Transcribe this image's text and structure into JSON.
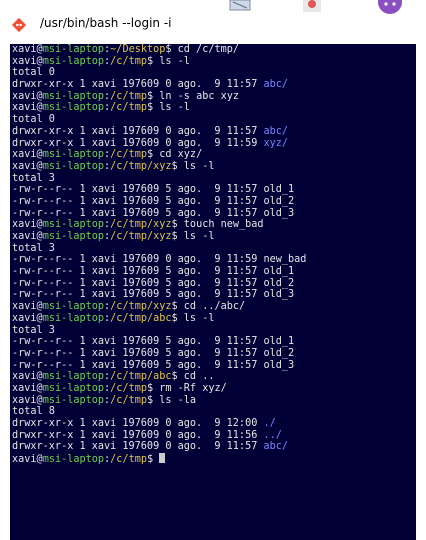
{
  "window": {
    "title": "/usr/bin/bash --login -i",
    "colors": {
      "terminal_bg": "#000037",
      "user": "#e6e6e6",
      "host": "#6fd04f",
      "path": "#e0c44a",
      "dir": "#7a84ff",
      "text": "#e6e6e6"
    }
  },
  "terminal": {
    "lines": [
      {
        "type": "prompt",
        "user": "xavi",
        "host": "msi-laptop",
        "path": "~/Desktop",
        "command": "cd /c/tmp/"
      },
      {
        "type": "prompt",
        "user": "xavi",
        "host": "msi-laptop",
        "path": "/c/tmp",
        "command": "ls -l"
      },
      {
        "type": "out",
        "text": "total 0"
      },
      {
        "type": "out",
        "text": "drwxr-xr-x 1 xavi 197609 0 ago.  9 11:57 ",
        "dir": "abc/"
      },
      {
        "type": "prompt",
        "user": "xavi",
        "host": "msi-laptop",
        "path": "/c/tmp",
        "command": "ln -s abc xyz"
      },
      {
        "type": "prompt",
        "user": "xavi",
        "host": "msi-laptop",
        "path": "/c/tmp",
        "command": "ls -l"
      },
      {
        "type": "out",
        "text": "total 0"
      },
      {
        "type": "out",
        "text": "drwxr-xr-x 1 xavi 197609 0 ago.  9 11:57 ",
        "dir": "abc/"
      },
      {
        "type": "out",
        "text": "drwxr-xr-x 1 xavi 197609 0 ago.  9 11:59 ",
        "dir": "xyz/"
      },
      {
        "type": "prompt",
        "user": "xavi",
        "host": "msi-laptop",
        "path": "/c/tmp",
        "command": "cd xyz/"
      },
      {
        "type": "prompt",
        "user": "xavi",
        "host": "msi-laptop",
        "path": "/c/tmp/xyz",
        "command": "ls -l"
      },
      {
        "type": "out",
        "text": "total 3"
      },
      {
        "type": "out",
        "text": "-rw-r--r-- 1 xavi 197609 5 ago.  9 11:57 old_1"
      },
      {
        "type": "out",
        "text": "-rw-r--r-- 1 xavi 197609 5 ago.  9 11:57 old_2"
      },
      {
        "type": "out",
        "text": "-rw-r--r-- 1 xavi 197609 5 ago.  9 11:57 old_3"
      },
      {
        "type": "prompt",
        "user": "xavi",
        "host": "msi-laptop",
        "path": "/c/tmp/xyz",
        "command": "touch new_bad"
      },
      {
        "type": "prompt",
        "user": "xavi",
        "host": "msi-laptop",
        "path": "/c/tmp/xyz",
        "command": "ls -l"
      },
      {
        "type": "out",
        "text": "total 3"
      },
      {
        "type": "out",
        "text": "-rw-r--r-- 1 xavi 197609 0 ago.  9 11:59 new_bad"
      },
      {
        "type": "out",
        "text": "-rw-r--r-- 1 xavi 197609 5 ago.  9 11:57 old_1"
      },
      {
        "type": "out",
        "text": "-rw-r--r-- 1 xavi 197609 5 ago.  9 11:57 old_2"
      },
      {
        "type": "out",
        "text": "-rw-r--r-- 1 xavi 197609 5 ago.  9 11:57 old_3"
      },
      {
        "type": "prompt",
        "user": "xavi",
        "host": "msi-laptop",
        "path": "/c/tmp/xyz",
        "command": "cd ../abc/"
      },
      {
        "type": "prompt",
        "user": "xavi",
        "host": "msi-laptop",
        "path": "/c/tmp/abc",
        "command": "ls -l"
      },
      {
        "type": "out",
        "text": "total 3"
      },
      {
        "type": "out",
        "text": "-rw-r--r-- 1 xavi 197609 5 ago.  9 11:57 old_1"
      },
      {
        "type": "out",
        "text": "-rw-r--r-- 1 xavi 197609 5 ago.  9 11:57 old_2"
      },
      {
        "type": "out",
        "text": "-rw-r--r-- 1 xavi 197609 5 ago.  9 11:57 old_3"
      },
      {
        "type": "prompt",
        "user": "xavi",
        "host": "msi-laptop",
        "path": "/c/tmp/abc",
        "command": "cd .."
      },
      {
        "type": "prompt",
        "user": "xavi",
        "host": "msi-laptop",
        "path": "/c/tmp",
        "command": "rm -Rf xyz/"
      },
      {
        "type": "prompt",
        "user": "xavi",
        "host": "msi-laptop",
        "path": "/c/tmp",
        "command": "ls -la"
      },
      {
        "type": "out",
        "text": "total 8"
      },
      {
        "type": "out",
        "text": "drwxr-xr-x 1 xavi 197609 0 ago.  9 12:00 ",
        "dir": "./"
      },
      {
        "type": "out",
        "text": "drwxr-xr-x 1 xavi 197609 0 ago.  9 11:56 ",
        "dir": "../"
      },
      {
        "type": "out",
        "text": "drwxr-xr-x 1 xavi 197609 0 ago.  9 11:57 ",
        "dir": "abc/"
      },
      {
        "type": "prompt",
        "user": "xavi",
        "host": "msi-laptop",
        "path": "/c/tmp",
        "command": "",
        "cursor": true
      }
    ]
  }
}
